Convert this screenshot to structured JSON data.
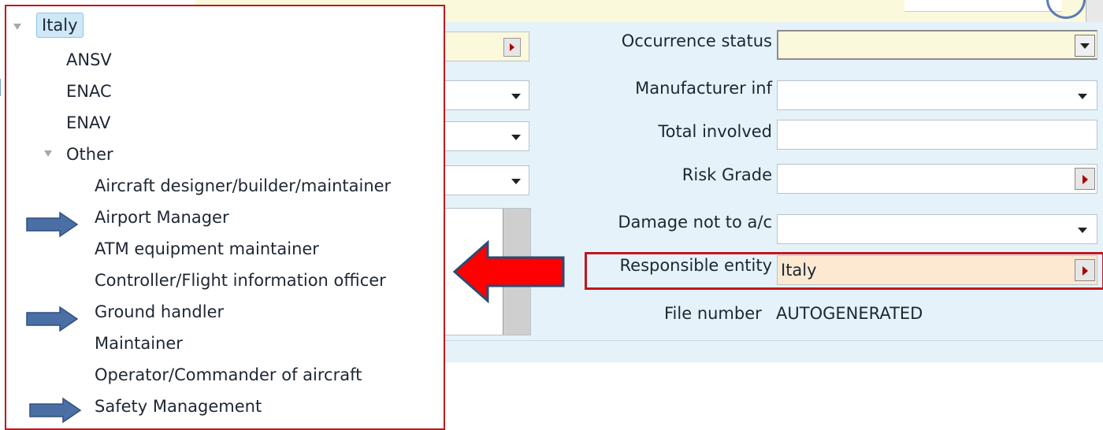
{
  "form": {
    "occurrence_status_label": "Occurrence status",
    "manufacturer_label": "Manufacturer inf",
    "total_involved_label": "Total involved",
    "risk_grade_label": "Risk Grade",
    "damage_label": "Damage not to a/c",
    "responsible_entity_label": "Responsible entity",
    "responsible_entity_value": "Italy",
    "file_number_label": "File number",
    "file_number_value": "AUTOGENERATED"
  },
  "tree": {
    "root": "Italy",
    "children": [
      "ANSV",
      "ENAC",
      "ENAV"
    ],
    "other_label": "Other",
    "other_children": [
      "Aircraft designer/builder/maintainer",
      "Airport Manager",
      "ATM equipment maintainer",
      "Controller/Flight information officer",
      "Ground handler",
      "Maintainer",
      "Operator/Commander of aircraft",
      "Safety Management"
    ]
  },
  "annotations": {
    "outline_color": "#c0171e",
    "red_arrow_color": "#ff0000",
    "blue_arrow_color": "#4a6fa5",
    "highlighted_items": [
      "Airport Manager",
      "Ground handler",
      "Safety Management"
    ]
  }
}
